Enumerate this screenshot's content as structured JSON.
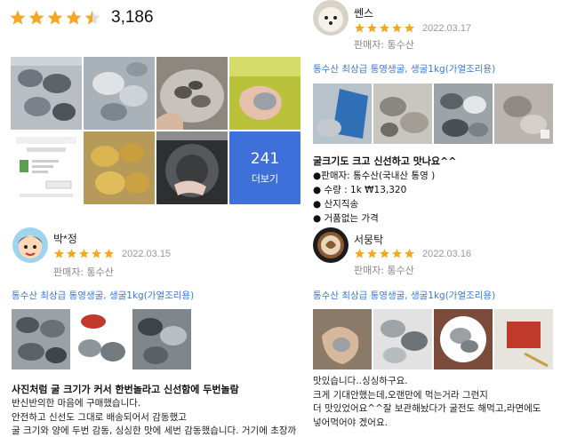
{
  "summary": {
    "rating": 4.5,
    "review_count": "3,186"
  },
  "photo_grid": {
    "more_count": "241",
    "more_label": "더보기"
  },
  "reviews": [
    {
      "name": "박*정",
      "stars": 5,
      "date": "2022.03.15",
      "seller": "판매자: 통수산",
      "product": "통수산 최상급 통영생굴, 생굴1kg(가열조리용)",
      "title": "사진처럼 굴 크기가 커서 한번놀라고 신선함에 두번놀람",
      "lines": [
        "반신반의한 마음에 구매했습니다.",
        "안전하고 신선도 그대로 배송되어서 감동했고",
        "굴 크기와 양에 두번 감동, 싱싱한 맛에 세번 감동했습니다. 거기에 초장까"
      ]
    },
    {
      "name": "쎈스",
      "stars": 5,
      "date": "2022.03.17",
      "seller": "판매자: 통수산",
      "product": "통수산 최상급 통영생굴, 생굴1kg(가열조리용)",
      "title": "굴크기도 크고 신선하고 맛나요^^",
      "bullets": [
        "●판매자: 통수산(국내산 통영 )",
        "● 수량  :  1k ₩13,320",
        "● 산지직송",
        "● 거품없는 가격"
      ]
    },
    {
      "name": "서뭉탁",
      "stars": 5,
      "date": "2022.03.16",
      "seller": "판매자: 통수산",
      "product": "통수산 최상급 통영생굴, 생굴1kg(가열조리용)",
      "lines": [
        "맛있습니다..싱싱하구요.",
        "크게 기대안했는데,오랜만에 먹는거라 그런지",
        "더 맛있었어요^^잘 보관해놨다가 굴전도 해먹고,라면에도",
        "넣어먹어야 겠어요."
      ]
    }
  ],
  "colors": {
    "star": "#f5a623",
    "link": "#3b7ad4",
    "more_tile": "#3f6fd8"
  }
}
